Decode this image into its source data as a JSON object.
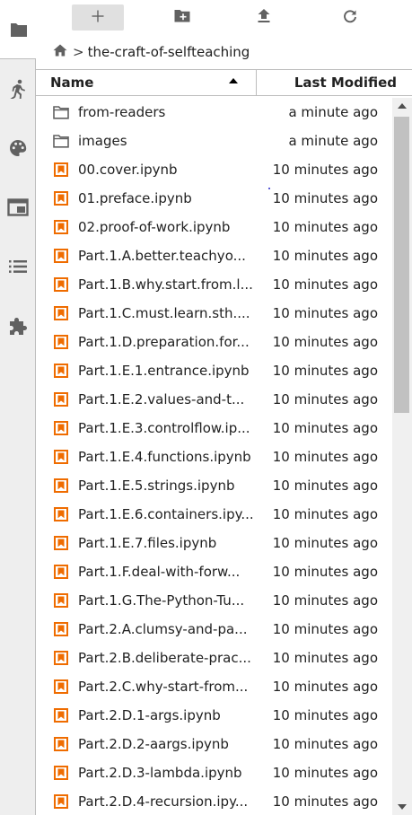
{
  "activity_bar": {
    "tabs": [
      {
        "name": "file-browser",
        "icon": "folder-icon",
        "active": true
      },
      {
        "name": "running",
        "icon": "running-person-icon",
        "active": false
      },
      {
        "name": "commands",
        "icon": "palette-icon",
        "active": false
      },
      {
        "name": "tabs",
        "icon": "tab-window-icon",
        "active": false
      },
      {
        "name": "toc",
        "icon": "list-icon",
        "active": false
      },
      {
        "name": "extensions",
        "icon": "puzzle-icon",
        "active": false
      }
    ]
  },
  "toolbar": {
    "buttons": [
      {
        "name": "new-launcher",
        "icon": "plus-icon"
      },
      {
        "name": "new-folder",
        "icon": "new-folder-icon"
      },
      {
        "name": "upload",
        "icon": "upload-icon"
      },
      {
        "name": "refresh",
        "icon": "refresh-icon"
      }
    ]
  },
  "breadcrumbs": {
    "home_icon": "home-icon",
    "separator": ">",
    "current": "the-craft-of-selfteaching"
  },
  "listing_header": {
    "name_label": "Name",
    "modified_label": "Last Modified",
    "sort": "ascending"
  },
  "files": [
    {
      "type": "folder",
      "name": "from-readers",
      "modified": "a minute ago"
    },
    {
      "type": "folder",
      "name": "images",
      "modified": "a minute ago"
    },
    {
      "type": "notebook",
      "name": "00.cover.ipynb",
      "modified": "10 minutes ago"
    },
    {
      "type": "notebook",
      "name": "01.preface.ipynb",
      "modified": "10 minutes ago"
    },
    {
      "type": "notebook",
      "name": "02.proof-of-work.ipynb",
      "modified": "10 minutes ago"
    },
    {
      "type": "notebook",
      "name": "Part.1.A.better.teachyo...",
      "modified": "10 minutes ago"
    },
    {
      "type": "notebook",
      "name": "Part.1.B.why.start.from.l...",
      "modified": "10 minutes ago"
    },
    {
      "type": "notebook",
      "name": "Part.1.C.must.learn.sth....",
      "modified": "10 minutes ago"
    },
    {
      "type": "notebook",
      "name": "Part.1.D.preparation.for...",
      "modified": "10 minutes ago"
    },
    {
      "type": "notebook",
      "name": "Part.1.E.1.entrance.ipynb",
      "modified": "10 minutes ago"
    },
    {
      "type": "notebook",
      "name": "Part.1.E.2.values-and-t...",
      "modified": "10 minutes ago"
    },
    {
      "type": "notebook",
      "name": "Part.1.E.3.controlflow.ip...",
      "modified": "10 minutes ago"
    },
    {
      "type": "notebook",
      "name": "Part.1.E.4.functions.ipynb",
      "modified": "10 minutes ago"
    },
    {
      "type": "notebook",
      "name": "Part.1.E.5.strings.ipynb",
      "modified": "10 minutes ago"
    },
    {
      "type": "notebook",
      "name": "Part.1.E.6.containers.ipy...",
      "modified": "10 minutes ago"
    },
    {
      "type": "notebook",
      "name": "Part.1.E.7.files.ipynb",
      "modified": "10 minutes ago"
    },
    {
      "type": "notebook",
      "name": "Part.1.F.deal-with-forw...",
      "modified": "10 minutes ago"
    },
    {
      "type": "notebook",
      "name": "Part.1.G.The-Python-Tu...",
      "modified": "10 minutes ago"
    },
    {
      "type": "notebook",
      "name": "Part.2.A.clumsy-and-pa...",
      "modified": "10 minutes ago"
    },
    {
      "type": "notebook",
      "name": "Part.2.B.deliberate-prac...",
      "modified": "10 minutes ago"
    },
    {
      "type": "notebook",
      "name": "Part.2.C.why-start-from...",
      "modified": "10 minutes ago"
    },
    {
      "type": "notebook",
      "name": "Part.2.D.1-args.ipynb",
      "modified": "10 minutes ago"
    },
    {
      "type": "notebook",
      "name": "Part.2.D.2-aargs.ipynb",
      "modified": "10 minutes ago"
    },
    {
      "type": "notebook",
      "name": "Part.2.D.3-lambda.ipynb",
      "modified": "10 minutes ago"
    },
    {
      "type": "notebook",
      "name": "Part.2.D.4-recursion.ipy...",
      "modified": "10 minutes ago"
    }
  ],
  "colors": {
    "notebook_icon": "#ef6c00",
    "folder_icon": "#616161",
    "activity_icon": "#616161",
    "activity_bar_bg": "#eeeeee",
    "header_border": "#bdbdbd"
  }
}
